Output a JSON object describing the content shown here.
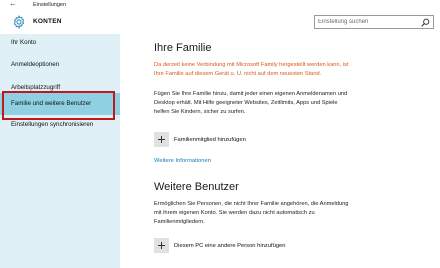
{
  "window": {
    "title": "Einstellungen",
    "back_glyph": "←"
  },
  "header": {
    "section_title": "KONTEN",
    "search_placeholder": "Einstellung suchen"
  },
  "sidebar": {
    "items": [
      {
        "label": "Ihr Konto",
        "selected": false
      },
      {
        "label": "Anmeldeoptionen",
        "selected": false
      },
      {
        "label": "Arbeitsplatzzugriff",
        "selected": false
      },
      {
        "label": "Familie und weitere Benutzer",
        "selected": true
      },
      {
        "label": "Einstellungen synchronisieren",
        "selected": false
      }
    ]
  },
  "main": {
    "family": {
      "heading": "Ihre Familie",
      "warning": "Da derzeit keine Verbindung mit Microsoft Family hergestellt werden kann, ist Ihre Familie auf diesem Gerät u. U. nicht auf dem neuesten Stand.",
      "description": "Fügen Sie Ihre Familie hinzu, damit jeder einen eigenen Anmeldenamen und Desktop erhält. Mit Hilfe geeigneter Websites, Zeitlimits, Apps und Spiele helfen Sie Kindern, sicher zu surfen.",
      "add_label": "Familienmitglied hinzufügen",
      "more_info_link": "Weitere Informationen"
    },
    "others": {
      "heading": "Weitere Benutzer",
      "description": "Ermöglichen Sie Personen, die nicht Ihrer Familie angehören, die Anmeldung mit ihrem eigenen Konto. Sie werden dazu nicht automatisch zu Familienmitgliedern.",
      "add_label": "Diesem PC eine andere Person hinzufügen"
    }
  },
  "colors": {
    "accent": "#3a8ec0",
    "sidebar_bg": "#dff1f6",
    "selected_bg": "#8fd0e3",
    "warning_text": "#d85a13",
    "link": "#1a7bb6",
    "highlight_border": "#c0181c"
  },
  "icons": {
    "header": "gear-icon",
    "search": "search-icon",
    "add": "plus-icon"
  }
}
